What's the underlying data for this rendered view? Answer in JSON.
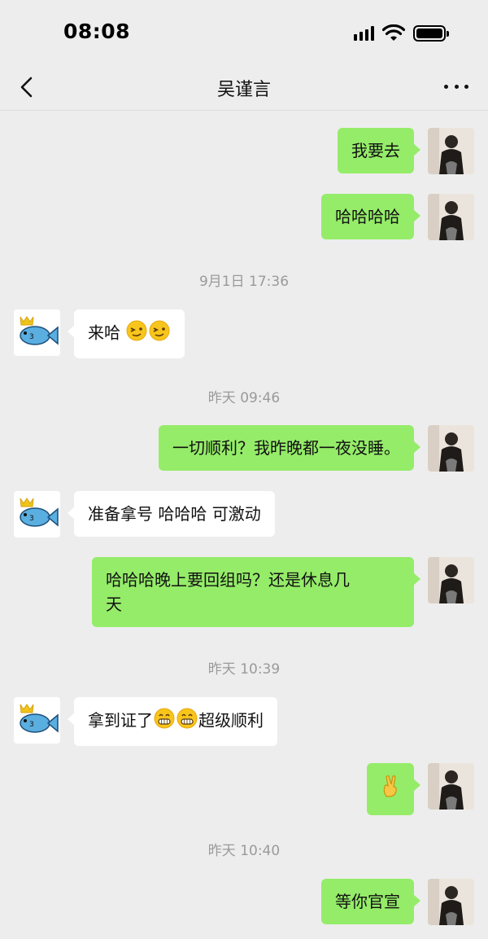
{
  "status_bar": {
    "time": "08:08"
  },
  "header": {
    "title": "吴谨言"
  },
  "messages": [
    {
      "from": "me",
      "text": "我要去"
    },
    {
      "from": "me",
      "text": "哈哈哈哈"
    },
    {
      "type": "timestamp",
      "text": "9月1日 17:36"
    },
    {
      "from": "them",
      "text": "来哈",
      "emojis": [
        "wink-face",
        "wink-face"
      ]
    },
    {
      "type": "timestamp",
      "text": "昨天 09:46"
    },
    {
      "from": "me",
      "text": "一切顺利？我昨晚都一夜没睡。"
    },
    {
      "from": "them",
      "text": "准备拿号 哈哈哈 可激动"
    },
    {
      "from": "me",
      "line1": "哈哈哈晚上要回组吗？还是休息几",
      "line2": "天"
    },
    {
      "type": "timestamp",
      "text": "昨天 10:39"
    },
    {
      "from": "them",
      "text_before": "拿到证了",
      "text_after": "超级顺利",
      "emojis": [
        "grin-face",
        "grin-face"
      ]
    },
    {
      "from": "me",
      "emoji": "victory-hand"
    },
    {
      "type": "timestamp",
      "text": "昨天 10:40"
    },
    {
      "from": "me",
      "text": "等你官宣"
    }
  ],
  "colors": {
    "background": "#ededed",
    "my_bubble": "#95ec69",
    "their_bubble": "#ffffff",
    "timestamp": "#9a9a9a"
  }
}
